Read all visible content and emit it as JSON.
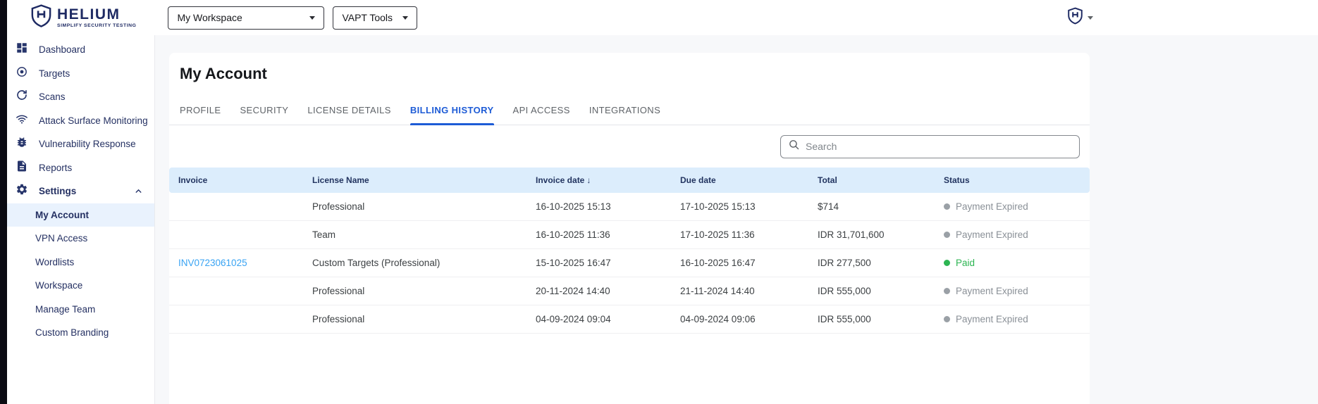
{
  "brand": {
    "name": "HELIUM",
    "tagline": "SIMPLIFY SECURITY TESTING",
    "color": "#1e2a63"
  },
  "topbar": {
    "workspace_select": {
      "value": "My Workspace"
    },
    "tools_select": {
      "value": "VAPT Tools"
    }
  },
  "sidebar": {
    "items": [
      {
        "label": "Dashboard",
        "icon": "dashboard-icon"
      },
      {
        "label": "Targets",
        "icon": "target-icon"
      },
      {
        "label": "Scans",
        "icon": "scan-icon"
      },
      {
        "label": "Attack Surface Monitoring",
        "icon": "wifi-icon"
      },
      {
        "label": "Vulnerability Response",
        "icon": "bug-icon"
      },
      {
        "label": "Reports",
        "icon": "report-icon"
      },
      {
        "label": "Settings",
        "icon": "gear-icon",
        "expanded": true
      }
    ],
    "settings_children": [
      {
        "label": "My Account",
        "active": true
      },
      {
        "label": "VPN Access",
        "active": false
      },
      {
        "label": "Wordlists",
        "active": false
      },
      {
        "label": "Workspace",
        "active": false
      },
      {
        "label": "Manage Team",
        "active": false
      },
      {
        "label": "Custom Branding",
        "active": false
      }
    ]
  },
  "main": {
    "title": "My Account",
    "tabs": [
      {
        "label": "PROFILE",
        "active": false
      },
      {
        "label": "SECURITY",
        "active": false
      },
      {
        "label": "LICENSE DETAILS",
        "active": false
      },
      {
        "label": "BILLING HISTORY",
        "active": true
      },
      {
        "label": "API ACCESS",
        "active": false
      },
      {
        "label": "INTEGRATIONS",
        "active": false
      }
    ],
    "search": {
      "placeholder": "Search"
    },
    "table": {
      "columns": [
        "Invoice",
        "License Name",
        "Invoice date",
        "Due date",
        "Total",
        "Status"
      ],
      "sort_column": "Invoice date",
      "sort_direction": "desc",
      "sort_icon": "↓",
      "rows": [
        {
          "invoice": "",
          "license_name": "Professional",
          "invoice_date": "16-10-2025 15:13",
          "due_date": "17-10-2025 15:13",
          "total": "$714",
          "status": "Payment Expired",
          "status_color": "#9aa0a6",
          "status_text_color": "#8a9097"
        },
        {
          "invoice": "",
          "license_name": "Team",
          "invoice_date": "16-10-2025 11:36",
          "due_date": "17-10-2025 11:36",
          "total": "IDR 31,701,600",
          "status": "Payment Expired",
          "status_color": "#9aa0a6",
          "status_text_color": "#8a9097"
        },
        {
          "invoice": "INV0723061025",
          "license_name": "Custom Targets (Professional)",
          "invoice_date": "15-10-2025 16:47",
          "due_date": "16-10-2025 16:47",
          "total": "IDR 277,500",
          "status": "Paid",
          "status_color": "#2cb552",
          "status_text_color": "#2cb552"
        },
        {
          "invoice": "",
          "license_name": "Professional",
          "invoice_date": "20-11-2024 14:40",
          "due_date": "21-11-2024 14:40",
          "total": "IDR 555,000",
          "status": "Payment Expired",
          "status_color": "#9aa0a6",
          "status_text_color": "#8a9097"
        },
        {
          "invoice": "",
          "license_name": "Professional",
          "invoice_date": "04-09-2024 09:04",
          "due_date": "04-09-2024 09:06",
          "total": "IDR 555,000",
          "status": "Payment Expired",
          "status_color": "#9aa0a6",
          "status_text_color": "#8a9097"
        }
      ]
    }
  }
}
